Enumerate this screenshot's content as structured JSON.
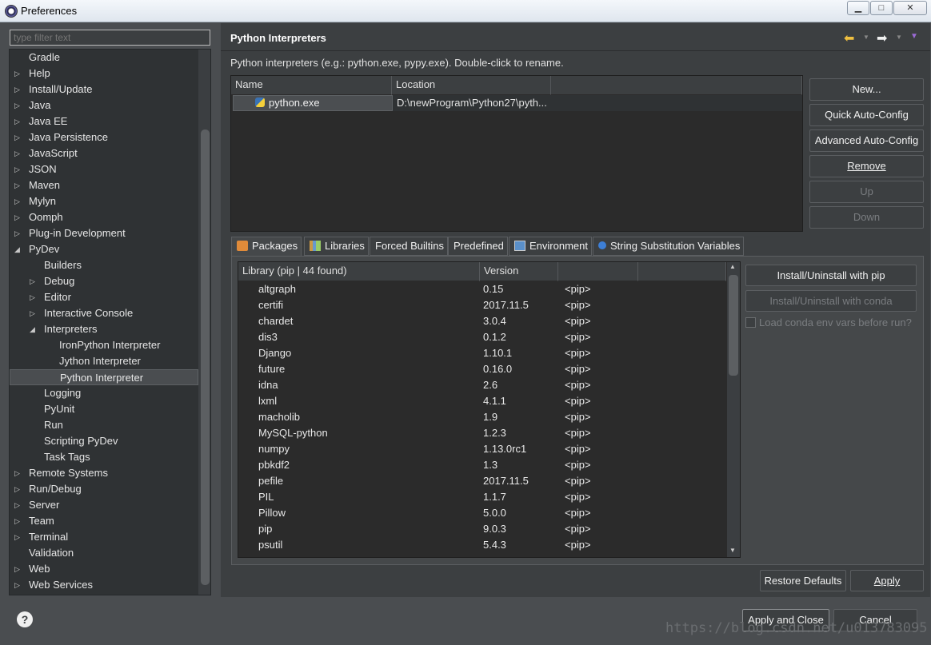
{
  "window": {
    "title": "Preferences",
    "min_label": "▁",
    "max_label": "□",
    "close_label": "✕"
  },
  "filter": {
    "placeholder": "type filter text"
  },
  "tree": [
    {
      "label": "Gradle",
      "depth": 0,
      "arrow": ""
    },
    {
      "label": "Help",
      "depth": 0,
      "arrow": "▷"
    },
    {
      "label": "Install/Update",
      "depth": 0,
      "arrow": "▷"
    },
    {
      "label": "Java",
      "depth": 0,
      "arrow": "▷"
    },
    {
      "label": "Java EE",
      "depth": 0,
      "arrow": "▷"
    },
    {
      "label": "Java Persistence",
      "depth": 0,
      "arrow": "▷"
    },
    {
      "label": "JavaScript",
      "depth": 0,
      "arrow": "▷"
    },
    {
      "label": "JSON",
      "depth": 0,
      "arrow": "▷"
    },
    {
      "label": "Maven",
      "depth": 0,
      "arrow": "▷"
    },
    {
      "label": "Mylyn",
      "depth": 0,
      "arrow": "▷"
    },
    {
      "label": "Oomph",
      "depth": 0,
      "arrow": "▷"
    },
    {
      "label": "Plug-in Development",
      "depth": 0,
      "arrow": "▷"
    },
    {
      "label": "PyDev",
      "depth": 0,
      "arrow": "◢"
    },
    {
      "label": "Builders",
      "depth": 1,
      "arrow": ""
    },
    {
      "label": "Debug",
      "depth": 1,
      "arrow": "▷"
    },
    {
      "label": "Editor",
      "depth": 1,
      "arrow": "▷"
    },
    {
      "label": "Interactive Console",
      "depth": 1,
      "arrow": "▷"
    },
    {
      "label": "Interpreters",
      "depth": 1,
      "arrow": "◢"
    },
    {
      "label": "IronPython Interpreter",
      "depth": 2,
      "arrow": ""
    },
    {
      "label": "Jython Interpreter",
      "depth": 2,
      "arrow": ""
    },
    {
      "label": "Python Interpreter",
      "depth": 2,
      "arrow": "",
      "selected": true
    },
    {
      "label": "Logging",
      "depth": 1,
      "arrow": ""
    },
    {
      "label": "PyUnit",
      "depth": 1,
      "arrow": ""
    },
    {
      "label": "Run",
      "depth": 1,
      "arrow": ""
    },
    {
      "label": "Scripting PyDev",
      "depth": 1,
      "arrow": ""
    },
    {
      "label": "Task Tags",
      "depth": 1,
      "arrow": ""
    },
    {
      "label": "Remote Systems",
      "depth": 0,
      "arrow": "▷"
    },
    {
      "label": "Run/Debug",
      "depth": 0,
      "arrow": "▷"
    },
    {
      "label": "Server",
      "depth": 0,
      "arrow": "▷"
    },
    {
      "label": "Team",
      "depth": 0,
      "arrow": "▷"
    },
    {
      "label": "Terminal",
      "depth": 0,
      "arrow": "▷"
    },
    {
      "label": "Validation",
      "depth": 0,
      "arrow": ""
    },
    {
      "label": "Web",
      "depth": 0,
      "arrow": "▷"
    },
    {
      "label": "Web Services",
      "depth": 0,
      "arrow": "▷"
    }
  ],
  "page": {
    "title": "Python Interpreters",
    "description": "Python interpreters (e.g.: python.exe, pypy.exe).   Double-click to rename.",
    "back_icon": "back-arrow-icon",
    "forward_icon": "forward-arrow-icon"
  },
  "interpreters": {
    "col_name": "Name",
    "col_location": "Location",
    "rows": [
      {
        "name": "python.exe",
        "location": "D:\\newProgram\\Python27\\pyth..."
      }
    ]
  },
  "side_buttons": {
    "new": "New...",
    "quick": "Quick Auto-Config",
    "advanced": "Advanced Auto-Config",
    "remove": "Remove",
    "up": "Up",
    "down": "Down"
  },
  "tabs": [
    "Packages",
    "Libraries",
    "Forced Builtins",
    "Predefined",
    "Environment",
    "String Substitution Variables"
  ],
  "packages": {
    "col_library": "Library (pip | 44 found)",
    "col_version": "Version",
    "rows": [
      {
        "name": "altgraph",
        "version": "0.15",
        "src": "<pip>"
      },
      {
        "name": "certifi",
        "version": "2017.11.5",
        "src": "<pip>"
      },
      {
        "name": "chardet",
        "version": "3.0.4",
        "src": "<pip>"
      },
      {
        "name": "dis3",
        "version": "0.1.2",
        "src": "<pip>"
      },
      {
        "name": "Django",
        "version": "1.10.1",
        "src": "<pip>"
      },
      {
        "name": "future",
        "version": "0.16.0",
        "src": "<pip>"
      },
      {
        "name": "idna",
        "version": "2.6",
        "src": "<pip>"
      },
      {
        "name": "lxml",
        "version": "4.1.1",
        "src": "<pip>"
      },
      {
        "name": "macholib",
        "version": "1.9",
        "src": "<pip>"
      },
      {
        "name": "MySQL-python",
        "version": "1.2.3",
        "src": "<pip>"
      },
      {
        "name": "numpy",
        "version": "1.13.0rc1",
        "src": "<pip>"
      },
      {
        "name": "pbkdf2",
        "version": "1.3",
        "src": "<pip>"
      },
      {
        "name": "pefile",
        "version": "2017.11.5",
        "src": "<pip>"
      },
      {
        "name": "PIL",
        "version": "1.1.7",
        "src": "<pip>"
      },
      {
        "name": "Pillow",
        "version": "5.0.0",
        "src": "<pip>"
      },
      {
        "name": "pip",
        "version": "9.0.3",
        "src": "<pip>"
      },
      {
        "name": "psutil",
        "version": "5.4.3",
        "src": "<pip>"
      }
    ]
  },
  "pkg_actions": {
    "pip": "Install/Uninstall with pip",
    "conda": "Install/Uninstall with conda",
    "conda_env": "Load conda env vars before run?"
  },
  "footer": {
    "restore": "Restore Defaults",
    "apply": "Apply",
    "apply_close": "Apply and Close",
    "cancel": "Cancel",
    "help": "?",
    "watermark": "https://blog.csdn.net/u013783095"
  }
}
